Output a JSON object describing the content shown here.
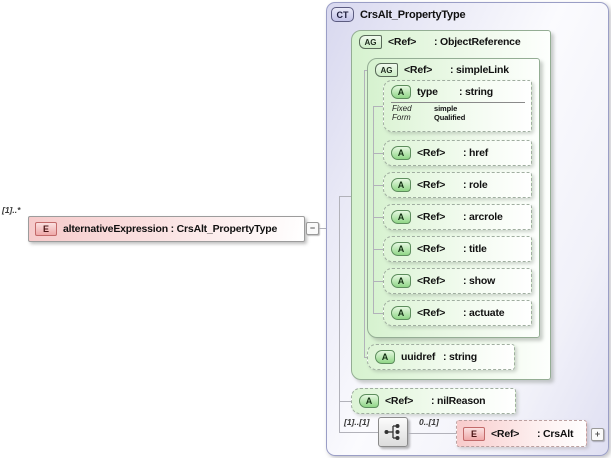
{
  "icons": {
    "element": "E",
    "attribute": "A",
    "attribute_group": "AG",
    "complex_type": "CT",
    "collapse": "−",
    "expand": "+"
  },
  "root_element": {
    "cardinality": "[1]..*",
    "label": "alternativeExpression : CrsAlt_PropertyType"
  },
  "complex_type": {
    "title": "CrsAlt_PropertyType",
    "object_reference": {
      "name": "<Ref>",
      "type": ": ObjectReference",
      "simple_link": {
        "name": "<Ref>",
        "type": ": simpleLink",
        "type_attribute": {
          "name": "type",
          "type": ": string",
          "facets": [
            {
              "label": "Fixed",
              "value": "simple"
            },
            {
              "label": "Form",
              "value": "Qualified"
            }
          ]
        },
        "ref_attributes": [
          {
            "name": "<Ref>",
            "type": ": href"
          },
          {
            "name": "<Ref>",
            "type": ": role"
          },
          {
            "name": "<Ref>",
            "type": ": arcrole"
          },
          {
            "name": "<Ref>",
            "type": ": title"
          },
          {
            "name": "<Ref>",
            "type": ": show"
          },
          {
            "name": "<Ref>",
            "type": ": actuate"
          }
        ]
      },
      "uuidref_attribute": {
        "name": "uuidref",
        "type": ": string"
      }
    },
    "nil_reason_attribute": {
      "name": "<Ref>",
      "type": ": nilReason"
    },
    "sequence": {
      "cardinality": "[1]..[1]",
      "child_cardinality": "0..[1]",
      "crsalt_element": {
        "name": "<Ref>",
        "type": ": CrsAlt"
      }
    }
  },
  "colors": {
    "complex_type_fill": "#dcdcf2",
    "group_fill": "#d6f2cf",
    "attribute_fill": "#ddf4d6",
    "element_fill": "#f6caca",
    "connector": "#b2b2ba"
  }
}
